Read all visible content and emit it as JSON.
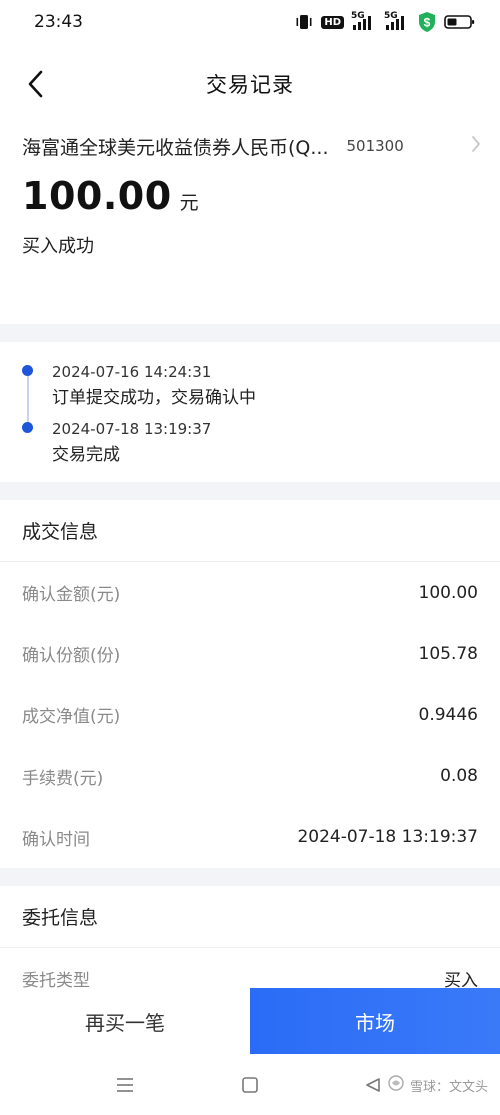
{
  "status_bar": {
    "time": "23:43",
    "hd_badge": "HD",
    "signal_1_label": "5G",
    "signal_2_label": "5G"
  },
  "header": {
    "title": "交易记录"
  },
  "fund": {
    "name": "海富通全球美元收益债券人民币(Q...",
    "code": "501300",
    "amount": "100.00",
    "unit": "元",
    "status": "买入成功"
  },
  "timeline": [
    {
      "time": "2024-07-16 14:24:31",
      "desc": "订单提交成功，交易确认中"
    },
    {
      "time": "2024-07-18 13:19:37",
      "desc": "交易完成"
    }
  ],
  "deal_info": {
    "title": "成交信息",
    "rows": [
      {
        "label": "确认金额(元)",
        "value": "100.00"
      },
      {
        "label": "确认份额(份)",
        "value": "105.78"
      },
      {
        "label": "成交净值(元)",
        "value": "0.9446"
      },
      {
        "label": "手续费(元)",
        "value": "0.08"
      },
      {
        "label": "确认时间",
        "value": "2024-07-18 13:19:37"
      }
    ]
  },
  "order_info": {
    "title": "委托信息",
    "rows": [
      {
        "label": "委托类型",
        "value": "买入"
      }
    ]
  },
  "bottom_bar": {
    "buy_again": "再买一笔",
    "market": "市场"
  },
  "watermark": {
    "text": "雪球：文文头"
  },
  "colors": {
    "accent": "#2a6cf6",
    "timeline_dot": "#1f56d9",
    "divider": "#f3f4f8",
    "shield_green": "#21b15a"
  },
  "icons": {
    "back": "chevron-left-icon",
    "fund_link": "chevron-right-icon",
    "nav_menu": "menu-icon",
    "nav_home": "square-icon",
    "nav_back": "triangle-back-icon"
  }
}
